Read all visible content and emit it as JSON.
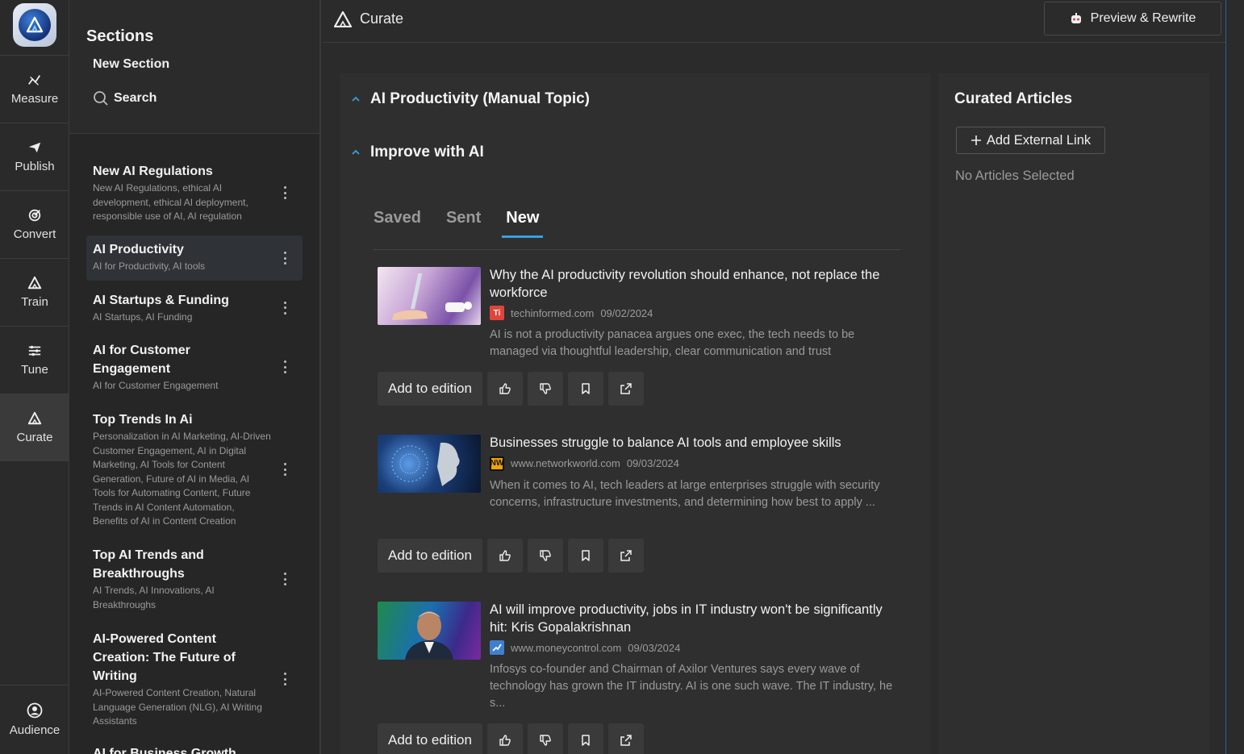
{
  "rail": {
    "items": [
      {
        "label": "Measure",
        "icon": "chart-line-icon"
      },
      {
        "label": "Publish",
        "icon": "send-icon"
      },
      {
        "label": "Convert",
        "icon": "target-icon"
      },
      {
        "label": "Train",
        "icon": "ai-logo-icon"
      },
      {
        "label": "Tune",
        "icon": "sliders-icon"
      },
      {
        "label": "Curate",
        "icon": "ai-logo-icon"
      }
    ],
    "audience": {
      "label": "Audience",
      "icon": "user-circle-icon"
    }
  },
  "sections": {
    "title": "Sections",
    "new_section": "New Section",
    "search": "Search",
    "items": [
      {
        "name": "New AI Regulations",
        "keywords": "New AI Regulations, ethical AI development, ethical AI deployment, responsible use of AI, AI regulation"
      },
      {
        "name": "AI Productivity",
        "keywords": "AI for Productivity, AI tools"
      },
      {
        "name": "AI Startups & Funding",
        "keywords": "AI Startups, AI Funding"
      },
      {
        "name": "AI for Customer Engagement",
        "keywords": "AI for Customer Engagement"
      },
      {
        "name": "Top Trends In Ai",
        "keywords": "Personalization in AI Marketing, AI-Driven Customer Engagement, AI in Digital Marketing, AI Tools for Content Generation, Future of AI in Media, AI Tools for Automating Content, Future Trends in AI Content Automation, Benefits of AI in Content Creation"
      },
      {
        "name": "Top AI Trends and Breakthroughs",
        "keywords": "AI Trends, AI Innovations, AI Breakthroughs"
      },
      {
        "name": "AI-Powered Content Creation: The Future of Writing",
        "keywords": "AI-Powered Content Creation, Natural Language Generation (NLG), AI Writing Assistants"
      },
      {
        "name": "AI for Business Growth",
        "keywords": ""
      }
    ]
  },
  "topbar": {
    "title": "Curate",
    "preview_button": "Preview & Rewrite"
  },
  "main": {
    "topic": "AI Productivity (Manual Topic)",
    "improve": "Improve with AI",
    "tabs": [
      "Saved",
      "Sent",
      "New"
    ],
    "add_label": "Add to edition",
    "articles": [
      {
        "title": "Why the AI productivity revolution should enhance, not replace the workforce",
        "source": "techinformed.com",
        "date": "09/02/2024",
        "favicon": "Ti",
        "description": "AI is not a productivity panacea argues one exec, the tech needs to be managed via thoughtful leadership, clear communication and trust"
      },
      {
        "title": "Businesses struggle to balance AI tools and employee skills",
        "source": "www.networkworld.com",
        "date": "09/03/2024",
        "favicon": "NW",
        "description": "When it comes to AI, tech leaders at large enterprises struggle with security concerns, infrastructure investments, and determining how best to apply ..."
      },
      {
        "title": "AI will improve productivity, jobs in IT industry won't be significantly hit: Kris Gopalakrishnan",
        "source": "www.moneycontrol.com",
        "date": "09/03/2024",
        "favicon": "",
        "description": "Infosys co-founder and Chairman of Axilor Ventures says every wave of technology has grown the IT industry. AI is one such wave. The IT industry, he s..."
      }
    ]
  },
  "curated": {
    "title": "Curated Articles",
    "add_link": "Add External Link",
    "empty": "No Articles Selected"
  },
  "colors": {
    "accent": "#3a9fe0",
    "background": "#2b2b2b",
    "panel": "#2f2f2f"
  }
}
